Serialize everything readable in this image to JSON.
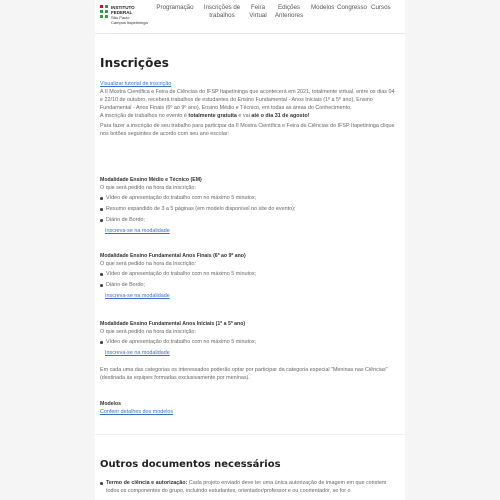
{
  "header": {
    "logo": {
      "line1": "INSTITUTO FEDERAL",
      "line2": "São Paulo",
      "line3": "Campus Itapetininga"
    },
    "nav": [
      {
        "label": "Programação"
      },
      {
        "label": "Inscrições de trabalhos"
      },
      {
        "label": "Feira Virtual"
      },
      {
        "label": "Edições Anteriores"
      },
      {
        "label": "Modelos"
      },
      {
        "label": "Congresso"
      },
      {
        "label": "Cursos"
      }
    ]
  },
  "main": {
    "title": "Inscrições",
    "tutorial_link": "Visualizar tutorial de inscrição",
    "intro": "A II Mostra Científica e Feira de Ciências do IFSP Itapetininga que acontecerá em 2021, totalmente virtual, entre os dias 04 e 22/10 de outubro, receberá trabalhos de estudantes do Ensino Fundamental - Anos Iniciais (1º a 5º ano), Ensino Fundamental - Anos Finais (6º ao 9º ano), Ensino Médio e Técnico, em todas as áreas do Conhecimento.",
    "free_pre": "A inscrição de trabalhos no evento é ",
    "free_bold": "totalmente gratuita",
    "free_mid": " e vai ",
    "free_bold2": "até o dia 31 de agosto!",
    "choose": "Para fazer a inscrição de seu trabalho para participar da II Mostra Científica e Feira de Ciências do IFSP Itapetininga clique nos botões seguintes de acordo com seu ano escolar:",
    "modalities": [
      {
        "title": "Modalidade Ensino Médio e Técnico (EM)",
        "ask": "O que será pedido na hora da inscrição:",
        "items": [
          "Vídeo de apresentação do trabalho com no máximo 5 minutos;",
          "Resumo expandido de 3 a 5 páginas (em modelo disponível no site do evento);",
          "Diário de Bordo;"
        ],
        "link": "Inscreva-se na modalidade"
      },
      {
        "title": "Modalidade Ensino Fundamental Anos Finais (6º ao 9º ano)",
        "ask": "O que será pedido na hora da inscrição:",
        "items": [
          "Vídeo de apresentação do trabalho com no máximo 5 minutos;",
          "Diário de Bordo;"
        ],
        "link": "Inscreva-se na modalidade"
      },
      {
        "title": "Modalidade Ensino Fundamental Anos Iniciais (1º a 5º ano)",
        "ask": "O que será pedido na hora da inscrição:",
        "items": [
          "Vídeo de apresentação do trabalho com no máximo 5 minutos;"
        ],
        "link": "Inscreva-se na modalidade"
      }
    ],
    "special": "Em cada uma das categorias os interessados poderão optar por participar da categoria especial \"Meninas nas Ciências\" (destinada às equipes formadas exclusivamente por meninas).",
    "models_title": "Modelos",
    "models_link": "Conferir detalhes dos modelos"
  },
  "section2": {
    "title": "Outros documentos necessários",
    "item_bold": "Termo de ciência e autorização:",
    "item_text": " Cada projeto enviado deve ter uma única autorização de imagem em que constem todos os componentes do grupo, incluindo estudantes, orientador/professor e ou coorientador, se for o"
  }
}
